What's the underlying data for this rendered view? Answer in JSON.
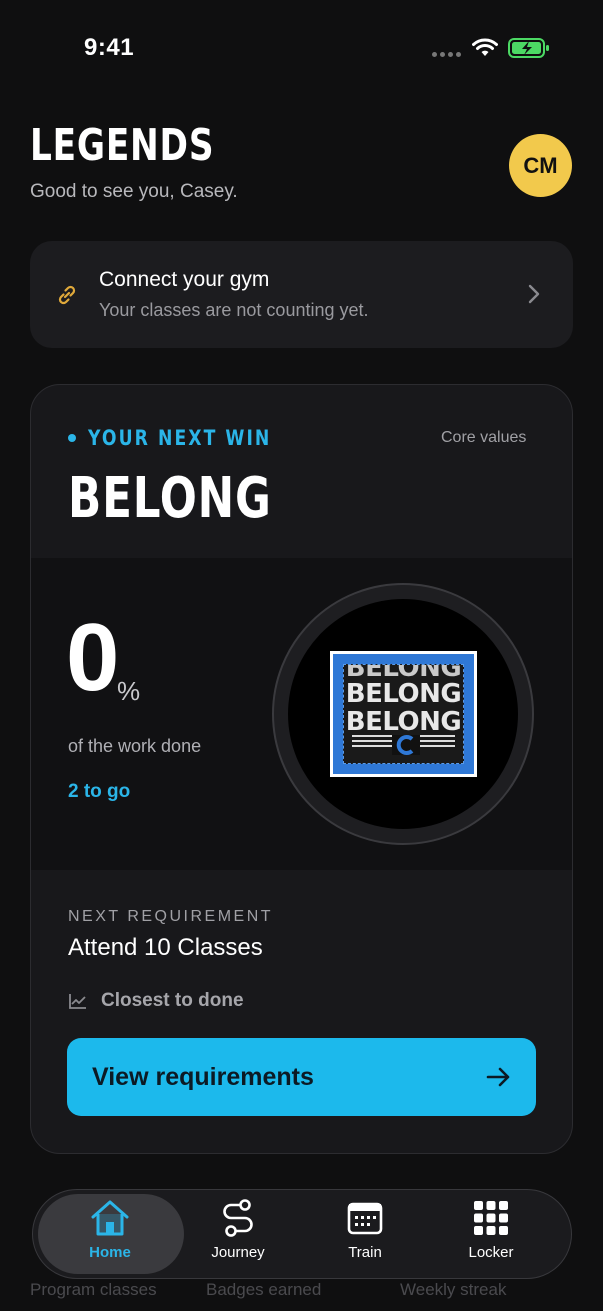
{
  "status_bar": {
    "time": "9:41"
  },
  "header": {
    "brand": "LEGENDS",
    "greeting": "Good to see you, Casey.",
    "avatar_initials": "CM"
  },
  "gym_card": {
    "title": "Connect your gym",
    "subtitle": "Your classes are not counting yet.",
    "icon": "link-icon"
  },
  "win_card": {
    "kicker": "YOUR NEXT WIN",
    "category": "Core values",
    "badge_name": "BELONG",
    "progress_value": "0",
    "progress_unit": "%",
    "progress_caption": "of the work done",
    "remaining": "2 to go",
    "patch_words": [
      "BELONG",
      "BELONG",
      "BELONG"
    ],
    "requirement_label": "NEXT REQUIREMENT",
    "requirement_text": "Attend 10 Classes",
    "hint": "Closest to done",
    "cta_label": "View requirements"
  },
  "stats_peek": [
    "Program classes",
    "Badges earned",
    "Weekly streak"
  ],
  "tabs": [
    {
      "label": "Home",
      "icon": "home-icon",
      "active": true
    },
    {
      "label": "Journey",
      "icon": "route-icon",
      "active": false
    },
    {
      "label": "Train",
      "icon": "calendar-icon",
      "active": false
    },
    {
      "label": "Locker",
      "icon": "grid-icon",
      "active": false
    }
  ],
  "colors": {
    "accent": "#1cb9ec",
    "avatar": "#f2c94c",
    "link_icon": "#e0a93a",
    "background": "#0f0f10"
  }
}
